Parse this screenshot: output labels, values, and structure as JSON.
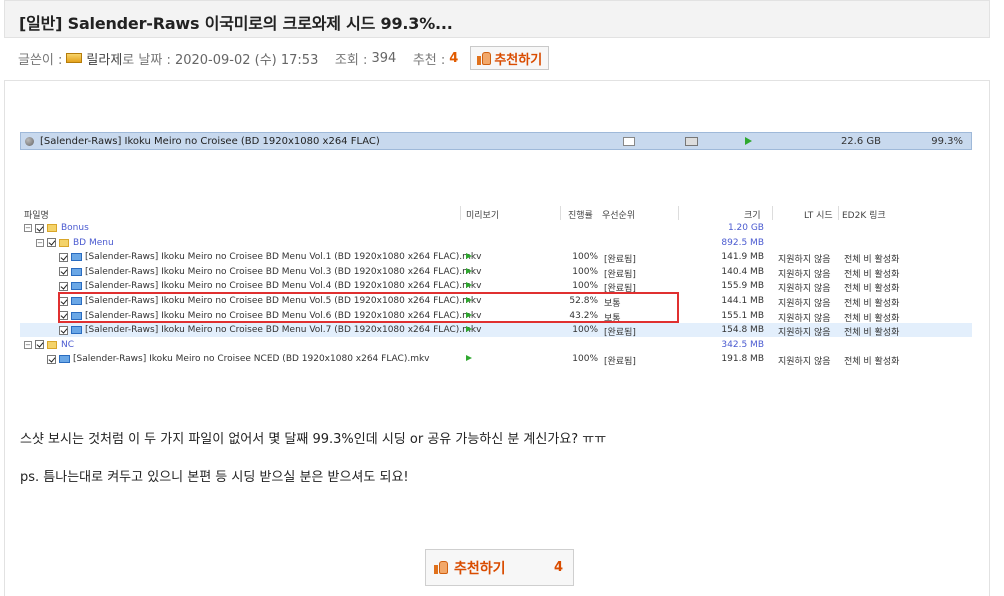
{
  "post": {
    "title": "[일반] Salender-Raws 이국미로의 크로와제 시드 99.3%...",
    "meta": {
      "author_label": "글쓴이 :",
      "author": "릴라제",
      "date_label": "로 날짜 :",
      "date": "2020-09-02 (수) 17:53",
      "views_label": "조회 :",
      "views": "394",
      "rec_label": "추천 :",
      "rec_count": "4",
      "rec_button": "추천하기"
    },
    "body": {
      "line1": "스샷 보시는 것처럼 이 두 가지 파일이 없어서 몇 달째 99.3%인데 시딩 or 공유 가능하신 분 계신가요? ㅠㅠ",
      "line2": "ps. 틈나는대로 켜두고 있으니 본편 등 시딩 받으실 분은 받으셔도 되요!"
    },
    "bottom_rec": {
      "label": "추천하기",
      "count": "4"
    }
  },
  "screenshot": {
    "torrent": {
      "name": "[Salender-Raws] Ikoku Meiro no Croisee (BD 1920x1080 x264 FLAC)",
      "size": "22.6 GB",
      "progress": "99.3%"
    },
    "headers": {
      "name": "파일명",
      "preview": "미리보기",
      "progress": "진행률",
      "priority": "우선순위",
      "size": "크기",
      "lt": "LT 시드",
      "ed2k": "ED2K 링크"
    },
    "rows": [
      {
        "type": "folder",
        "level": 0,
        "name": "Bonus",
        "progress": "",
        "priority": "",
        "size": "1.20 GB",
        "lt": "",
        "ed": ""
      },
      {
        "type": "folder",
        "level": 1,
        "name": "BD Menu",
        "progress": "",
        "priority": "",
        "size": "892.5 MB",
        "lt": "",
        "ed": ""
      },
      {
        "type": "file",
        "level": 2,
        "name": "[Salender-Raws] Ikoku Meiro no Croisee BD Menu Vol.1 (BD 1920x1080 x264 FLAC).mkv",
        "progress": "100%",
        "priority": "[완료됨]",
        "size": "141.9 MB",
        "lt": "지원하지 않음",
        "ed": "전체 비 활성화"
      },
      {
        "type": "file",
        "level": 2,
        "name": "[Salender-Raws] Ikoku Meiro no Croisee BD Menu Vol.3 (BD 1920x1080 x264 FLAC).mkv",
        "progress": "100%",
        "priority": "[완료됨]",
        "size": "140.4 MB",
        "lt": "지원하지 않음",
        "ed": "전체 비 활성화"
      },
      {
        "type": "file",
        "level": 2,
        "name": "[Salender-Raws] Ikoku Meiro no Croisee BD Menu Vol.4 (BD 1920x1080 x264 FLAC).mkv",
        "progress": "100%",
        "priority": "[완료됨]",
        "size": "155.9 MB",
        "lt": "지원하지 않음",
        "ed": "전체 비 활성화"
      },
      {
        "type": "file",
        "level": 2,
        "name": "[Salender-Raws] Ikoku Meiro no Croisee BD Menu Vol.5 (BD 1920x1080 x264 FLAC).mkv",
        "progress": "52.8%",
        "priority": "보통",
        "size": "144.1 MB",
        "lt": "지원하지 않음",
        "ed": "전체 비 활성화"
      },
      {
        "type": "file",
        "level": 2,
        "name": "[Salender-Raws] Ikoku Meiro no Croisee BD Menu Vol.6 (BD 1920x1080 x264 FLAC).mkv",
        "progress": "43.2%",
        "priority": "보통",
        "size": "155.1 MB",
        "lt": "지원하지 않음",
        "ed": "전체 비 활성화"
      },
      {
        "type": "file",
        "level": 2,
        "name": "[Salender-Raws] Ikoku Meiro no Croisee BD Menu Vol.7 (BD 1920x1080 x264 FLAC).mkv",
        "progress": "100%",
        "priority": "[완료됨]",
        "size": "154.8 MB",
        "lt": "지원하지 않음",
        "ed": "전체 비 활성화"
      },
      {
        "type": "folder",
        "level": 0,
        "name": "NC",
        "progress": "",
        "priority": "",
        "size": "342.5 MB",
        "lt": "",
        "ed": ""
      },
      {
        "type": "file",
        "level": 1,
        "name": "[Salender-Raws] Ikoku Meiro no Croisee NCED (BD 1920x1080 x264 FLAC).mkv",
        "progress": "100%",
        "priority": "[완료됨]",
        "size": "191.8 MB",
        "lt": "지원하지 않음",
        "ed": "전체 비 활성화"
      }
    ]
  }
}
